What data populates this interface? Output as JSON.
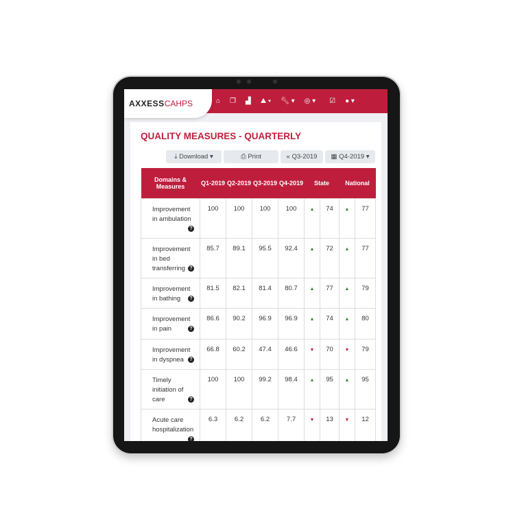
{
  "nav": {
    "logo_text": "AXXESS",
    "logo_suffix": "CAHPS",
    "icons": [
      "home-icon",
      "copy-icon",
      "chart-icon",
      "map-icon",
      "wrench-icon",
      "globe-icon",
      "calendar-check-icon",
      "user-icon"
    ]
  },
  "page": {
    "title": "QUALITY MEASURES - QUARTERLY"
  },
  "toolbar": {
    "download": "Download",
    "print": "Print",
    "prev": "Q3-2019",
    "current": "Q4-2019"
  },
  "table": {
    "headers": [
      "Domains & Measures",
      "Q1-2019",
      "Q2-2019",
      "Q3-2019",
      "Q4-2019",
      "State",
      "National"
    ],
    "rows": [
      {
        "measure": "Improvement in ambulation",
        "q1": "100",
        "q2": "100",
        "q3": "100",
        "q4": "100",
        "state_trend": "up",
        "state": "74",
        "national_trend": "up",
        "national": "77"
      },
      {
        "measure": "Improvement in bed transferring",
        "q1": "85.7",
        "q2": "89.1",
        "q3": "95.5",
        "q4": "92.4",
        "state_trend": "up",
        "state": "72",
        "national_trend": "up",
        "national": "77"
      },
      {
        "measure": "Improvement in bathing",
        "q1": "81.5",
        "q2": "82.1",
        "q3": "81.4",
        "q4": "80.7",
        "state_trend": "up",
        "state": "77",
        "national_trend": "up",
        "national": "79"
      },
      {
        "measure": "Improvement in pain",
        "q1": "86.6",
        "q2": "90.2",
        "q3": "96.9",
        "q4": "96.9",
        "state_trend": "up",
        "state": "74",
        "national_trend": "up",
        "national": "80"
      },
      {
        "measure": "Improvement in dyspnea",
        "q1": "66.8",
        "q2": "60.2",
        "q3": "47.4",
        "q4": "46.6",
        "state_trend": "down",
        "state": "70",
        "national_trend": "down",
        "national": "79"
      },
      {
        "measure": "Timely initiation of care",
        "q1": "100",
        "q2": "100",
        "q3": "99.2",
        "q4": "98.4",
        "state_trend": "up",
        "state": "95",
        "national_trend": "up",
        "national": "95"
      },
      {
        "measure": "Acute care hospitalization",
        "q1": "6.3",
        "q2": "6.2",
        "q3": "6.2",
        "q4": "7.7",
        "state_trend": "down",
        "state": "13",
        "national_trend": "down",
        "national": "12"
      }
    ]
  },
  "colors": {
    "brand": "#be1e3c",
    "up": "#2e8b2e",
    "down": "#be1e3c"
  }
}
